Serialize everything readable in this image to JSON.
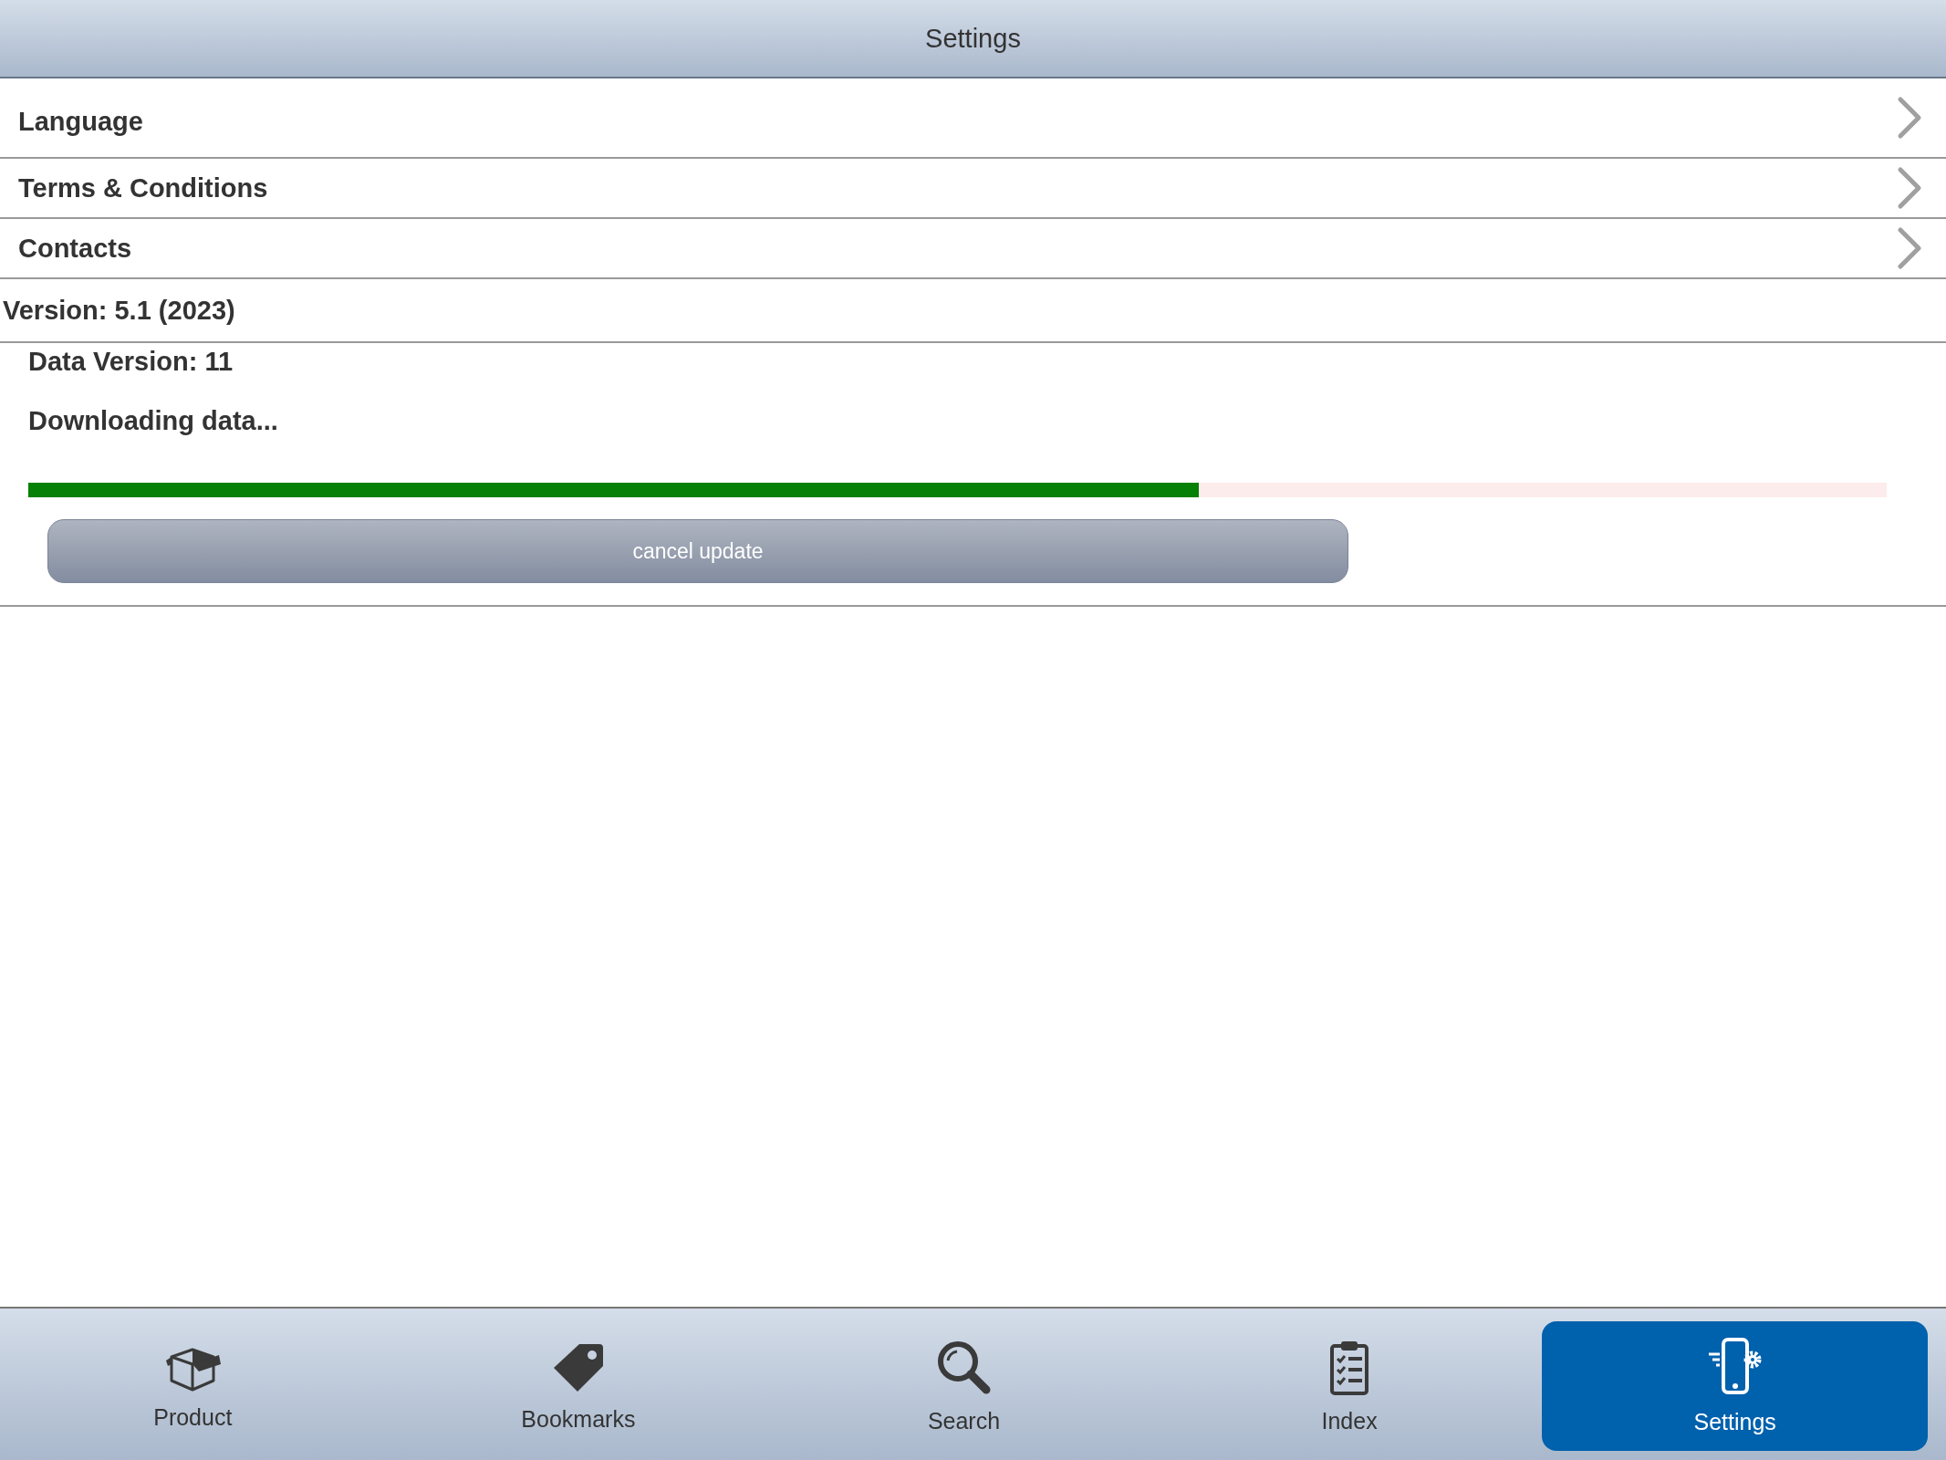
{
  "header": {
    "title": "Settings"
  },
  "menu_items": [
    {
      "label": "Language"
    },
    {
      "label": "Terms & Conditions"
    },
    {
      "label": "Contacts"
    }
  ],
  "version": "Version: 5.1 (2023)",
  "update": {
    "data_version": "Data Version: 11",
    "status": "Downloading data...",
    "level": 0.63,
    "button": "cancel update"
  },
  "tabs": [
    {
      "label": "Product",
      "selected": false
    },
    {
      "label": "Bookmarks",
      "selected": false
    },
    {
      "label": "Search",
      "selected": false
    },
    {
      "label": "Index",
      "selected": false
    },
    {
      "label": "Settings",
      "selected": true
    }
  ]
}
